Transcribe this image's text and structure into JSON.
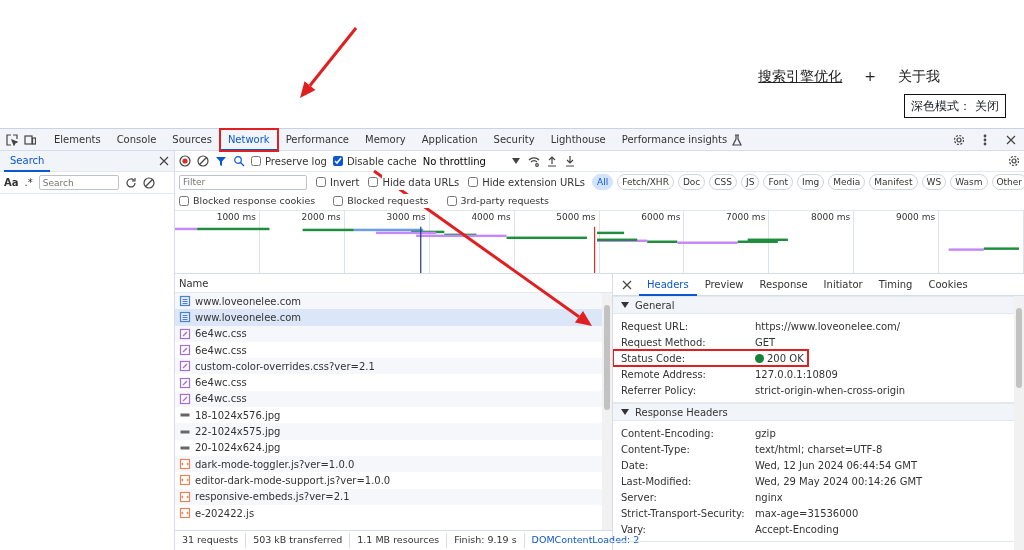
{
  "page": {
    "nav_links": [
      {
        "label": "搜索引擎优化",
        "underlined": true
      },
      {
        "label": "+",
        "underlined": false
      },
      {
        "label": "关于我",
        "underlined": false
      }
    ],
    "dark_mode": {
      "label": "深色模式：",
      "value": "关闭"
    }
  },
  "devtools": {
    "tabs": [
      {
        "label": "Elements",
        "selected": false,
        "highlighted": false
      },
      {
        "label": "Console",
        "selected": false,
        "highlighted": false
      },
      {
        "label": "Sources",
        "selected": false,
        "highlighted": false
      },
      {
        "label": "Network",
        "selected": true,
        "highlighted": true
      },
      {
        "label": "Performance",
        "selected": false,
        "highlighted": false
      },
      {
        "label": "Memory",
        "selected": false,
        "highlighted": false
      },
      {
        "label": "Application",
        "selected": false,
        "highlighted": false
      },
      {
        "label": "Security",
        "selected": false,
        "highlighted": false
      },
      {
        "label": "Lighthouse",
        "selected": false,
        "highlighted": false
      },
      {
        "label": "Performance insights",
        "selected": false,
        "highlighted": false
      }
    ],
    "search_panel": {
      "tab": "Search",
      "case_toggle": "Aa",
      "regex_toggle": ".*",
      "placeholder": "Search"
    },
    "toolbar": {
      "preserve_log": {
        "label": "Preserve log",
        "checked": false
      },
      "disable_cache": {
        "label": "Disable cache",
        "checked": true
      },
      "throttling": "No throttling"
    },
    "filter": {
      "placeholder": "Filter",
      "options": [
        {
          "label": "Invert",
          "checked": false
        },
        {
          "label": "Hide data URLs",
          "checked": false
        },
        {
          "label": "Hide extension URLs",
          "checked": false
        }
      ],
      "types": [
        {
          "label": "All",
          "selected": true
        },
        {
          "label": "Fetch/XHR",
          "selected": false
        },
        {
          "label": "Doc",
          "selected": false
        },
        {
          "label": "CSS",
          "selected": false
        },
        {
          "label": "JS",
          "selected": false
        },
        {
          "label": "Font",
          "selected": false
        },
        {
          "label": "Img",
          "selected": false
        },
        {
          "label": "Media",
          "selected": false
        },
        {
          "label": "Manifest",
          "selected": false
        },
        {
          "label": "WS",
          "selected": false
        },
        {
          "label": "Wasm",
          "selected": false
        },
        {
          "label": "Other",
          "selected": false
        }
      ],
      "more_options": [
        {
          "label": "Blocked response cookies",
          "checked": false
        },
        {
          "label": "Blocked requests",
          "checked": false
        },
        {
          "label": "3rd-party requests",
          "checked": false
        }
      ]
    },
    "timeline": {
      "ticks": [
        "1000 ms",
        "2000 ms",
        "3000 ms",
        "4000 ms",
        "5000 ms",
        "6000 ms",
        "7000 ms",
        "8000 ms",
        "9000 ms"
      ]
    },
    "requests": {
      "column": "Name",
      "rows": [
        {
          "name": "www.loveonelee.com",
          "kind": "doc",
          "selected": false
        },
        {
          "name": "www.loveonelee.com",
          "kind": "doc",
          "selected": true
        },
        {
          "name": "6e4wc.css",
          "kind": "css",
          "selected": false
        },
        {
          "name": "6e4wc.css",
          "kind": "css",
          "selected": false
        },
        {
          "name": "custom-color-overrides.css?ver=2.1",
          "kind": "css",
          "selected": false
        },
        {
          "name": "6e4wc.css",
          "kind": "css",
          "selected": false
        },
        {
          "name": "6e4wc.css",
          "kind": "css",
          "selected": false
        },
        {
          "name": "18-1024x576.jpg",
          "kind": "img",
          "selected": false
        },
        {
          "name": "22-1024x575.jpg",
          "kind": "img",
          "selected": false
        },
        {
          "name": "20-1024x624.jpg",
          "kind": "img",
          "selected": false
        },
        {
          "name": "dark-mode-toggler.js?ver=1.0.0",
          "kind": "js",
          "selected": false
        },
        {
          "name": "editor-dark-mode-support.js?ver=1.0.0",
          "kind": "js",
          "selected": false
        },
        {
          "name": "responsive-embeds.js?ver=2.1",
          "kind": "js",
          "selected": false
        },
        {
          "name": "e-202422.js",
          "kind": "js",
          "selected": false
        }
      ]
    },
    "status_bar": [
      {
        "text": "31 requests",
        "kind": "plain"
      },
      {
        "text": "503 kB transferred",
        "kind": "plain"
      },
      {
        "text": "1.1 MB resources",
        "kind": "plain"
      },
      {
        "text": "Finish: 9.19 s",
        "kind": "plain"
      },
      {
        "text": "DOMContentLoaded: 2",
        "kind": "link"
      }
    ],
    "details": {
      "tabs": [
        {
          "label": "Headers",
          "selected": true
        },
        {
          "label": "Preview",
          "selected": false
        },
        {
          "label": "Response",
          "selected": false
        },
        {
          "label": "Initiator",
          "selected": false
        },
        {
          "label": "Timing",
          "selected": false
        },
        {
          "label": "Cookies",
          "selected": false
        }
      ],
      "sections": [
        {
          "title": "General",
          "expanded": true,
          "rows": [
            {
              "key": "Request URL:",
              "value": "https://www.loveonelee.com/",
              "highlighted": false
            },
            {
              "key": "Request Method:",
              "value": "GET",
              "highlighted": false
            },
            {
              "key": "Status Code:",
              "value": "200 OK",
              "color": "#188038",
              "highlighted": true
            },
            {
              "key": "Remote Address:",
              "value": "127.0.0.1:10809",
              "highlighted": false
            },
            {
              "key": "Referrer Policy:",
              "value": "strict-origin-when-cross-origin",
              "highlighted": false
            }
          ]
        },
        {
          "title": "Response Headers",
          "expanded": true,
          "rows": [
            {
              "key": "Content-Encoding:",
              "value": "gzip",
              "highlighted": false
            },
            {
              "key": "Content-Type:",
              "value": "text/html; charset=UTF-8",
              "highlighted": false
            },
            {
              "key": "Date:",
              "value": "Wed, 12 Jun 2024 06:44:54 GMT",
              "highlighted": false
            },
            {
              "key": "Last-Modified:",
              "value": "Wed, 29 May 2024 00:14:26 GMT",
              "highlighted": false
            },
            {
              "key": "Server:",
              "value": "nginx",
              "highlighted": false
            },
            {
              "key": "Strict-Transport-Security:",
              "value": "max-age=31536000",
              "highlighted": false
            },
            {
              "key": "Vary:",
              "value": "Accept-Encoding",
              "highlighted": false
            }
          ]
        }
      ]
    }
  }
}
